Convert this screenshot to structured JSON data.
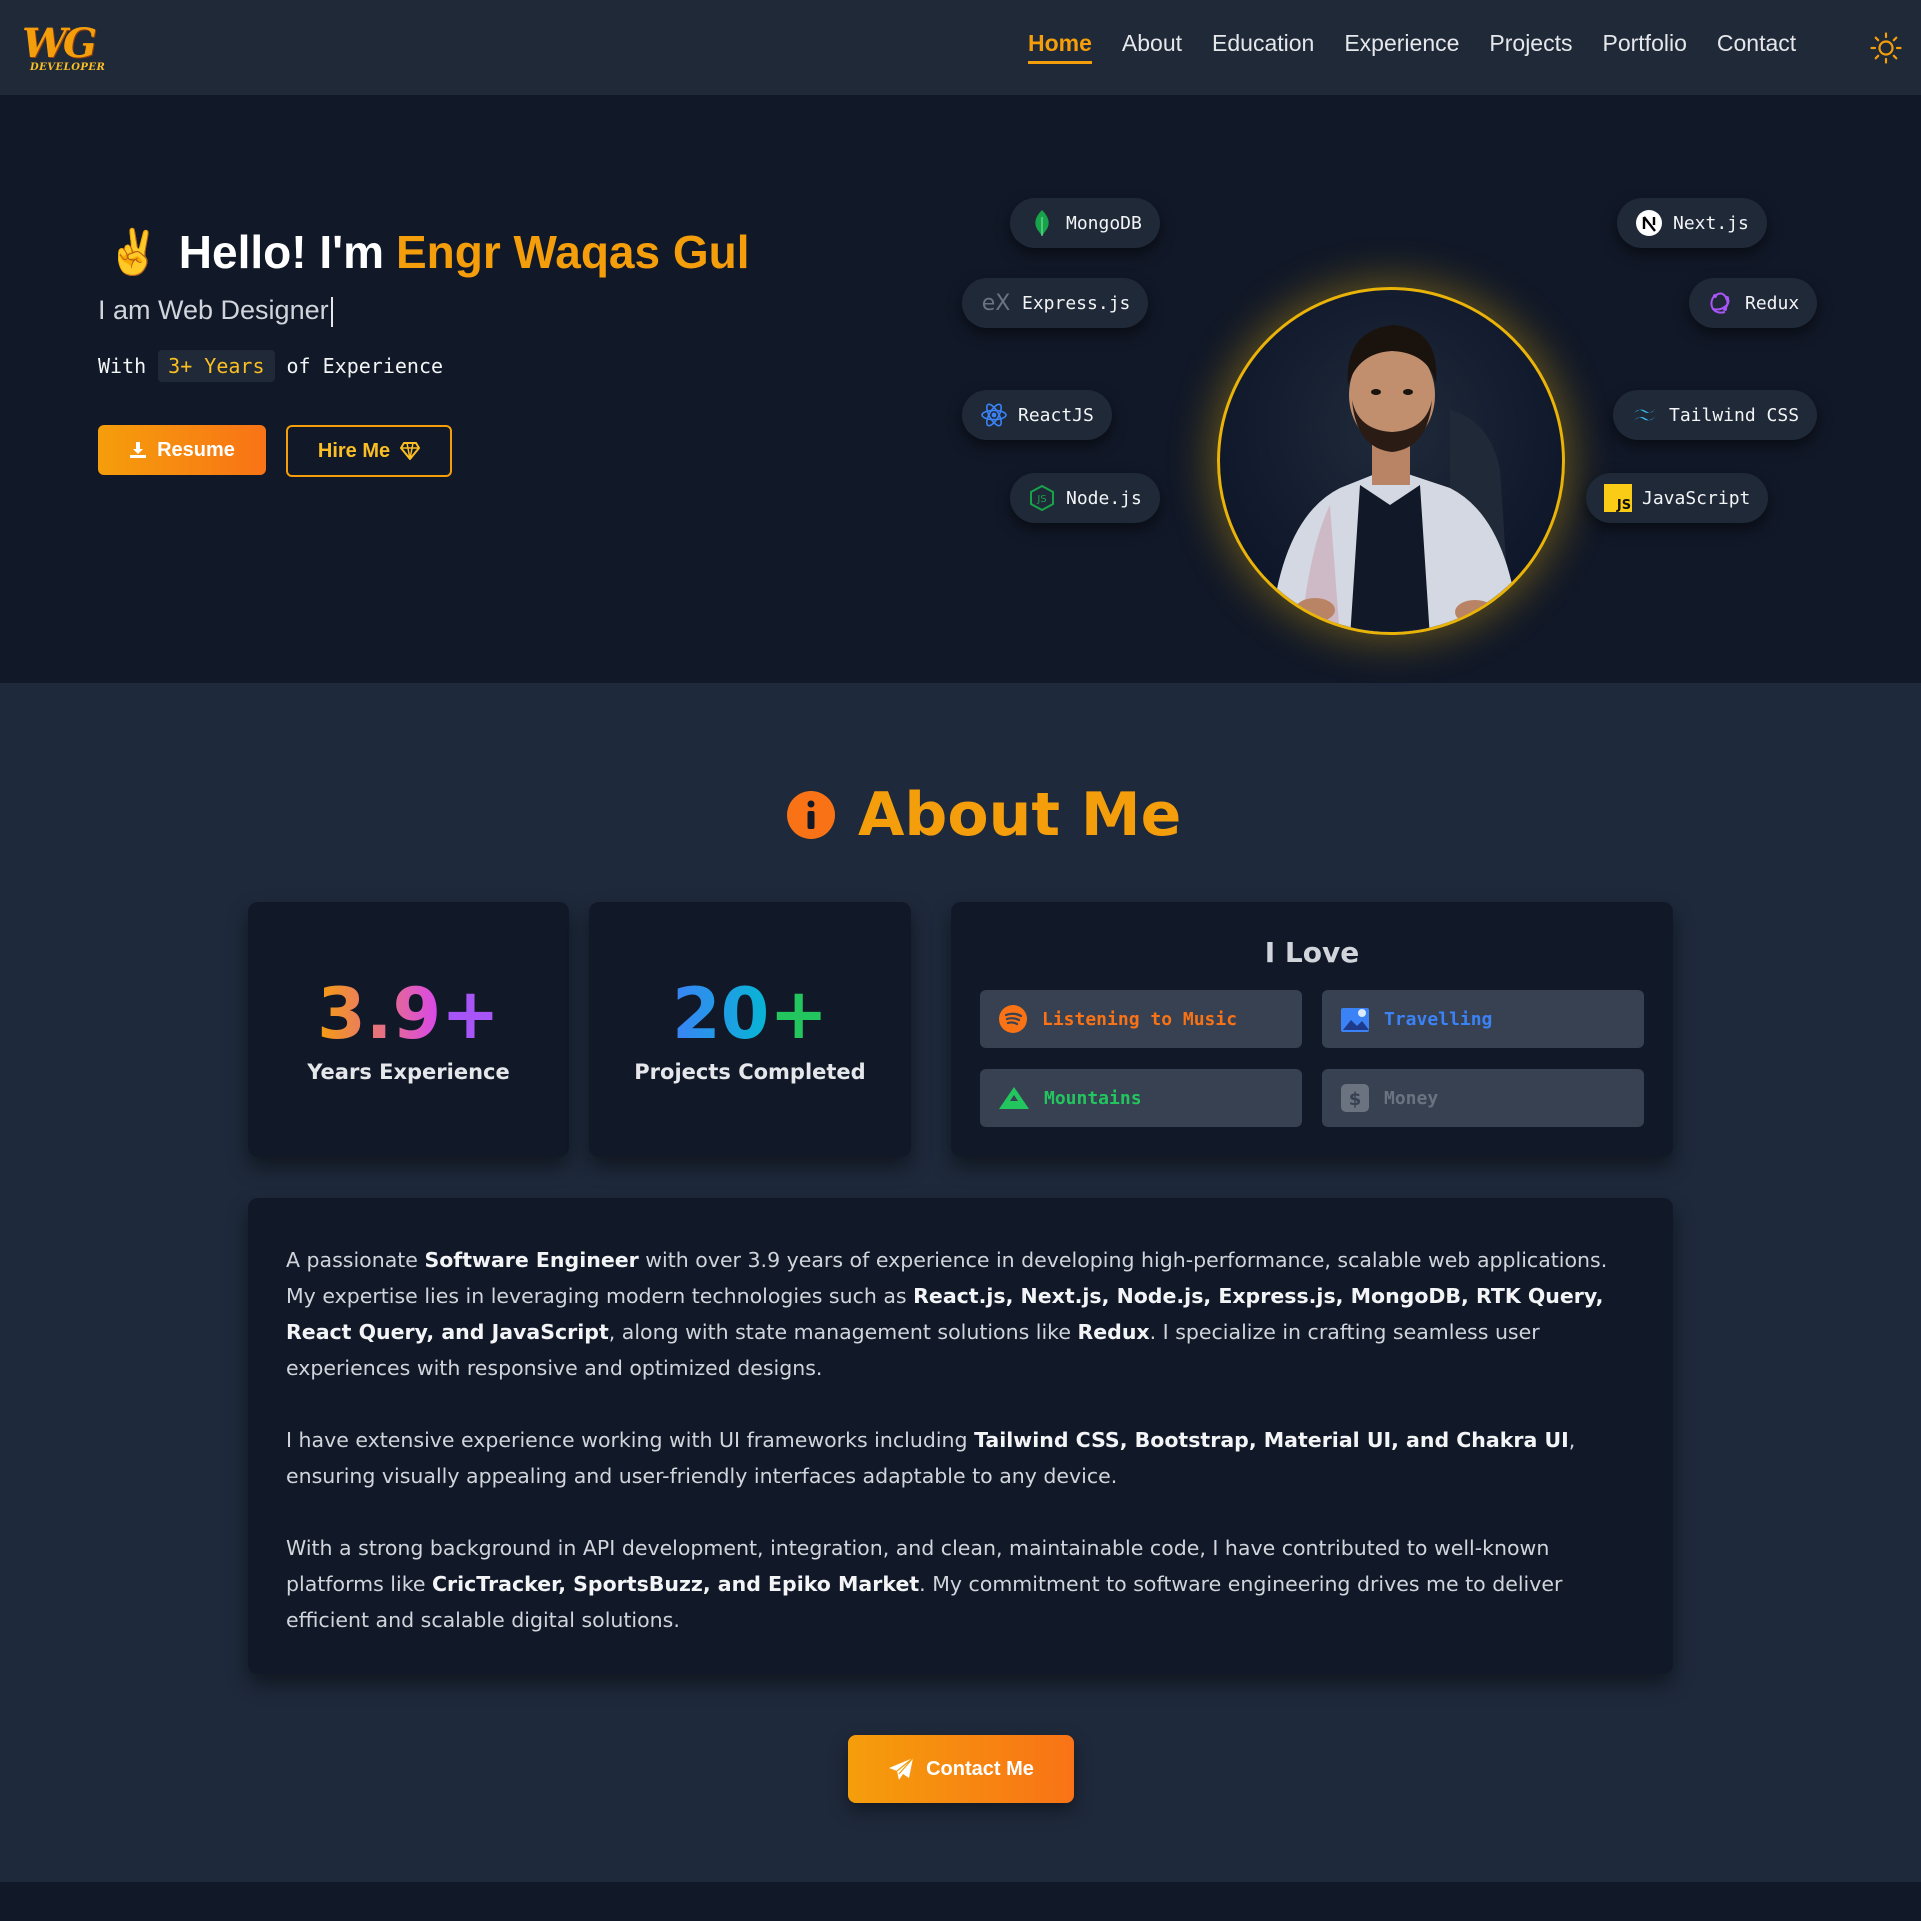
{
  "nav": {
    "logo_main": "WG",
    "logo_sub": "DEVELOPER",
    "links": [
      "Home",
      "About",
      "Education",
      "Experience",
      "Projects",
      "Portfolio",
      "Contact"
    ],
    "active": "Home",
    "theme_icon": "sun-icon",
    "accent": "#f59e0b"
  },
  "hero": {
    "emoji": "✌️",
    "greeting": "Hello! I'm",
    "name": "Engr Waqas Gul",
    "role": "I am Web Designer",
    "exp_prefix": "With",
    "exp_highlight": "3+ Years",
    "exp_suffix": "of Experience",
    "resume_label": "Resume",
    "hire_label": "Hire Me",
    "tech": [
      {
        "label": "MongoDB",
        "icon": "mongodb-leaf-icon"
      },
      {
        "label": "Express.js",
        "icon": "express-icon"
      },
      {
        "label": "ReactJS",
        "icon": "react-atom-icon"
      },
      {
        "label": "Node.js",
        "icon": "nodejs-hex-icon"
      },
      {
        "label": "Next.js",
        "icon": "nextjs-icon"
      },
      {
        "label": "Redux",
        "icon": "redux-icon"
      },
      {
        "label": "Tailwind CSS",
        "icon": "tailwind-icon"
      },
      {
        "label": "JavaScript",
        "icon": "javascript-icon"
      }
    ]
  },
  "about": {
    "title": "About Me",
    "stats": [
      {
        "number": "3.9",
        "suffix": "+",
        "label": "Years Experience"
      },
      {
        "number": "20",
        "suffix": "+",
        "label": "Projects Completed"
      }
    ],
    "love_title": "I Love",
    "loves": [
      {
        "label": "Listening to Music",
        "icon": "spotify-icon",
        "color": "#f97316"
      },
      {
        "label": "Travelling",
        "icon": "map-icon",
        "color": "#3b82f6"
      },
      {
        "label": "Mountains",
        "icon": "mountain-icon",
        "color": "#22c55e"
      },
      {
        "label": "Money",
        "icon": "dollar-icon",
        "color": "#6b7280"
      }
    ],
    "description_html": [
      "A passionate <b>Software Engineer</b> with over 3.9 years of experience in developing high-performance, scalable web applications. My expertise lies in leveraging modern technologies such as <b>React.js, Next.js, Node.js, Express.js, MongoDB, RTK Query, React Query, and JavaScript</b>, along with state management solutions like <b>Redux</b>. I specialize in crafting seamless user experiences with responsive and optimized designs.",
      "I have extensive experience working with UI frameworks including <b>Tailwind CSS, Bootstrap, Material UI, and Chakra UI</b>, ensuring visually appealing and user-friendly interfaces adaptable to any device.",
      "With a strong background in API development, integration, and clean, maintainable code, I have contributed to well-known platforms like <b>CricTracker, SportsBuzz, and Epiko Market</b>. My commitment to software engineering drives me to deliver efficient and scalable digital solutions."
    ],
    "contact_label": "Contact Me"
  }
}
